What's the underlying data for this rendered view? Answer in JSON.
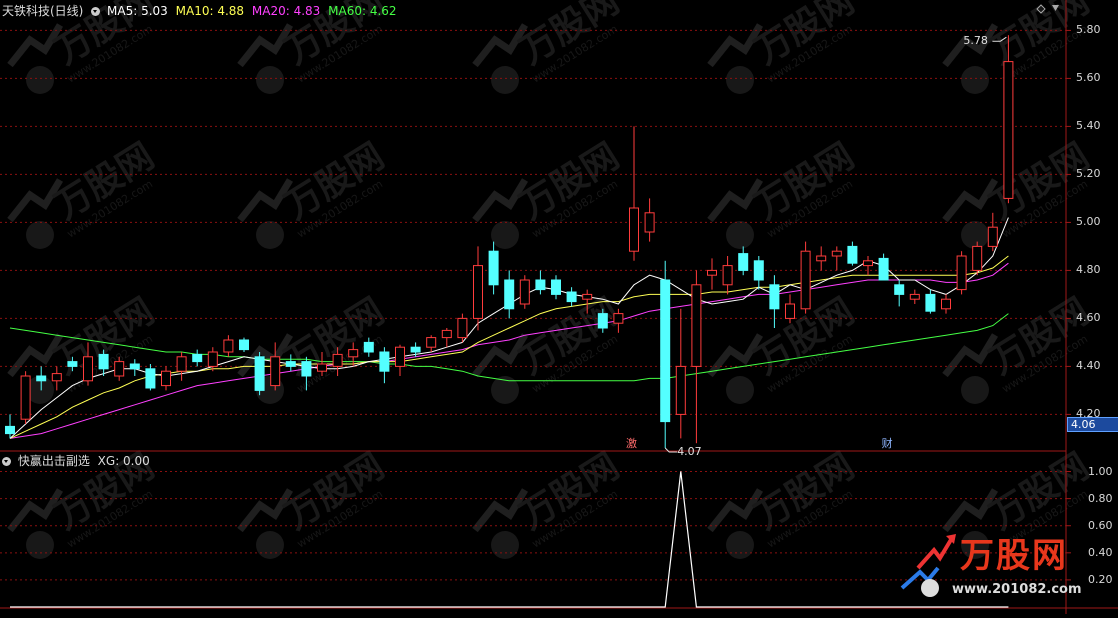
{
  "main_header": {
    "title": "天铁科技(日线)",
    "ma5": "MA5: 5.03",
    "ma10": "MA10: 4.88",
    "ma20": "MA20: 4.83",
    "ma60": "MA60: 4.62",
    "colors": {
      "title": "#dcdcdc",
      "ma5": "#ffffff",
      "ma10": "#ffff55",
      "ma20": "#ff40ff",
      "ma60": "#44ff44"
    }
  },
  "sub_header": {
    "title": "快赢出击副选",
    "xg": "XG: 0.00"
  },
  "markers": {
    "high_label": "5.78",
    "low_label": "4.07",
    "event_1": "激",
    "event_2": "财",
    "current_price": "4.06"
  },
  "watermark": {
    "brand": "万股网",
    "url": "www.201082.com"
  },
  "chart_data": [
    {
      "type": "candlestick",
      "ylim": [
        4.06,
        5.86
      ],
      "y_ticks": [
        "5.80",
        "5.60",
        "5.40",
        "5.20",
        "5.00",
        "4.80",
        "4.60",
        "4.40",
        "4.20"
      ],
      "tick_values": [
        5.8,
        5.6,
        5.4,
        5.2,
        5.0,
        4.8,
        4.6,
        4.4,
        4.2
      ],
      "colors": {
        "up": "#ff3c3c",
        "down": "#54ffff",
        "ma5": "#ffffff",
        "ma10": "#ffff55",
        "ma20": "#ff40ff",
        "ma60": "#44ff44",
        "grid": "#8a1010"
      },
      "candles": [
        {
          "o": 4.15,
          "h": 4.2,
          "l": 4.1,
          "c": 4.12
        },
        {
          "o": 4.18,
          "h": 4.38,
          "l": 4.16,
          "c": 4.36
        },
        {
          "o": 4.36,
          "h": 4.4,
          "l": 4.3,
          "c": 4.34
        },
        {
          "o": 4.34,
          "h": 4.4,
          "l": 4.3,
          "c": 4.37
        },
        {
          "o": 4.42,
          "h": 4.44,
          "l": 4.38,
          "c": 4.4
        },
        {
          "o": 4.34,
          "h": 4.5,
          "l": 4.32,
          "c": 4.44
        },
        {
          "o": 4.45,
          "h": 4.47,
          "l": 4.36,
          "c": 4.39
        },
        {
          "o": 4.36,
          "h": 4.44,
          "l": 4.34,
          "c": 4.42
        },
        {
          "o": 4.41,
          "h": 4.43,
          "l": 4.36,
          "c": 4.39
        },
        {
          "o": 4.39,
          "h": 4.41,
          "l": 4.3,
          "c": 4.31
        },
        {
          "o": 4.32,
          "h": 4.4,
          "l": 4.3,
          "c": 4.38
        },
        {
          "o": 4.38,
          "h": 4.46,
          "l": 4.34,
          "c": 4.44
        },
        {
          "o": 4.45,
          "h": 4.47,
          "l": 4.4,
          "c": 4.42
        },
        {
          "o": 4.4,
          "h": 4.48,
          "l": 4.38,
          "c": 4.46
        },
        {
          "o": 4.46,
          "h": 4.53,
          "l": 4.44,
          "c": 4.51
        },
        {
          "o": 4.51,
          "h": 4.52,
          "l": 4.46,
          "c": 4.47
        },
        {
          "o": 4.44,
          "h": 4.46,
          "l": 4.28,
          "c": 4.3
        },
        {
          "o": 4.32,
          "h": 4.5,
          "l": 4.3,
          "c": 4.44
        },
        {
          "o": 4.42,
          "h": 4.45,
          "l": 4.38,
          "c": 4.4
        },
        {
          "o": 4.42,
          "h": 4.44,
          "l": 4.3,
          "c": 4.36
        },
        {
          "o": 4.38,
          "h": 4.46,
          "l": 4.36,
          "c": 4.41
        },
        {
          "o": 4.4,
          "h": 4.48,
          "l": 4.36,
          "c": 4.45
        },
        {
          "o": 4.44,
          "h": 4.5,
          "l": 4.4,
          "c": 4.47
        },
        {
          "o": 4.5,
          "h": 4.52,
          "l": 4.44,
          "c": 4.46
        },
        {
          "o": 4.46,
          "h": 4.48,
          "l": 4.33,
          "c": 4.38
        },
        {
          "o": 4.4,
          "h": 4.49,
          "l": 4.36,
          "c": 4.48
        },
        {
          "o": 4.48,
          "h": 4.5,
          "l": 4.44,
          "c": 4.46
        },
        {
          "o": 4.48,
          "h": 4.53,
          "l": 4.46,
          "c": 4.52
        },
        {
          "o": 4.52,
          "h": 4.56,
          "l": 4.48,
          "c": 4.55
        },
        {
          "o": 4.52,
          "h": 4.62,
          "l": 4.5,
          "c": 4.6
        },
        {
          "o": 4.6,
          "h": 4.9,
          "l": 4.55,
          "c": 4.82
        },
        {
          "o": 4.88,
          "h": 4.92,
          "l": 4.7,
          "c": 4.74
        },
        {
          "o": 4.76,
          "h": 4.8,
          "l": 4.6,
          "c": 4.64
        },
        {
          "o": 4.66,
          "h": 4.78,
          "l": 4.64,
          "c": 4.76
        },
        {
          "o": 4.76,
          "h": 4.8,
          "l": 4.7,
          "c": 4.72
        },
        {
          "o": 4.76,
          "h": 4.78,
          "l": 4.68,
          "c": 4.7
        },
        {
          "o": 4.71,
          "h": 4.73,
          "l": 4.65,
          "c": 4.67
        },
        {
          "o": 4.68,
          "h": 4.72,
          "l": 4.62,
          "c": 4.7
        },
        {
          "o": 4.62,
          "h": 4.64,
          "l": 4.54,
          "c": 4.56
        },
        {
          "o": 4.58,
          "h": 4.64,
          "l": 4.54,
          "c": 4.62
        },
        {
          "o": 4.88,
          "h": 5.4,
          "l": 4.84,
          "c": 5.06
        },
        {
          "o": 4.96,
          "h": 5.1,
          "l": 4.92,
          "c": 5.04
        },
        {
          "o": 4.76,
          "h": 4.84,
          "l": 4.06,
          "c": 4.17
        },
        {
          "o": 4.2,
          "h": 4.64,
          "l": 4.1,
          "c": 4.4
        },
        {
          "o": 4.4,
          "h": 4.8,
          "l": 4.08,
          "c": 4.74
        },
        {
          "o": 4.78,
          "h": 4.85,
          "l": 4.72,
          "c": 4.8
        },
        {
          "o": 4.74,
          "h": 4.86,
          "l": 4.7,
          "c": 4.82
        },
        {
          "o": 4.87,
          "h": 4.9,
          "l": 4.78,
          "c": 4.8
        },
        {
          "o": 4.84,
          "h": 4.86,
          "l": 4.72,
          "c": 4.76
        },
        {
          "o": 4.74,
          "h": 4.78,
          "l": 4.56,
          "c": 4.64
        },
        {
          "o": 4.6,
          "h": 4.7,
          "l": 4.58,
          "c": 4.66
        },
        {
          "o": 4.64,
          "h": 4.92,
          "l": 4.62,
          "c": 4.88
        },
        {
          "o": 4.84,
          "h": 4.9,
          "l": 4.8,
          "c": 4.86
        },
        {
          "o": 4.86,
          "h": 4.9,
          "l": 4.8,
          "c": 4.88
        },
        {
          "o": 4.9,
          "h": 4.92,
          "l": 4.82,
          "c": 4.83
        },
        {
          "o": 4.82,
          "h": 4.86,
          "l": 4.78,
          "c": 4.84
        },
        {
          "o": 4.85,
          "h": 4.87,
          "l": 4.76,
          "c": 4.76
        },
        {
          "o": 4.74,
          "h": 4.76,
          "l": 4.65,
          "c": 4.7
        },
        {
          "o": 4.68,
          "h": 4.72,
          "l": 4.66,
          "c": 4.7
        },
        {
          "o": 4.7,
          "h": 4.72,
          "l": 4.62,
          "c": 4.63
        },
        {
          "o": 4.64,
          "h": 4.7,
          "l": 4.62,
          "c": 4.68
        },
        {
          "o": 4.72,
          "h": 4.88,
          "l": 4.7,
          "c": 4.86
        },
        {
          "o": 4.8,
          "h": 4.92,
          "l": 4.78,
          "c": 4.9
        },
        {
          "o": 4.9,
          "h": 5.04,
          "l": 4.88,
          "c": 4.98
        },
        {
          "o": 5.1,
          "h": 5.78,
          "l": 5.08,
          "c": 5.67
        }
      ],
      "ma5": [
        4.1,
        4.16,
        4.22,
        4.27,
        4.32,
        4.35,
        4.37,
        4.39,
        4.39,
        4.37,
        4.36,
        4.37,
        4.38,
        4.4,
        4.42,
        4.44,
        4.43,
        4.42,
        4.41,
        4.4,
        4.39,
        4.39,
        4.4,
        4.42,
        4.43,
        4.44,
        4.45,
        4.46,
        4.48,
        4.5,
        4.58,
        4.62,
        4.66,
        4.7,
        4.73,
        4.72,
        4.7,
        4.69,
        4.68,
        4.66,
        4.74,
        4.78,
        4.76,
        4.72,
        4.68,
        4.66,
        4.67,
        4.68,
        4.73,
        4.7,
        4.74,
        4.72,
        4.75,
        4.78,
        4.8,
        4.84,
        4.82,
        4.76,
        4.76,
        4.72,
        4.7,
        4.74,
        4.79,
        4.86,
        5.02
      ],
      "ma10": [
        4.1,
        4.13,
        4.16,
        4.19,
        4.23,
        4.26,
        4.29,
        4.31,
        4.34,
        4.36,
        4.37,
        4.38,
        4.38,
        4.39,
        4.39,
        4.4,
        4.4,
        4.4,
        4.41,
        4.41,
        4.41,
        4.41,
        4.41,
        4.42,
        4.42,
        4.42,
        4.43,
        4.44,
        4.45,
        4.46,
        4.5,
        4.53,
        4.56,
        4.59,
        4.62,
        4.64,
        4.65,
        4.66,
        4.67,
        4.67,
        4.69,
        4.7,
        4.7,
        4.7,
        4.7,
        4.71,
        4.71,
        4.72,
        4.73,
        4.73,
        4.74,
        4.75,
        4.76,
        4.77,
        4.78,
        4.78,
        4.78,
        4.78,
        4.78,
        4.78,
        4.78,
        4.78,
        4.79,
        4.81,
        4.86
      ],
      "ma20": [
        4.1,
        4.11,
        4.12,
        4.14,
        4.16,
        4.18,
        4.2,
        4.22,
        4.24,
        4.26,
        4.28,
        4.3,
        4.32,
        4.33,
        4.34,
        4.35,
        4.36,
        4.37,
        4.38,
        4.39,
        4.4,
        4.41,
        4.41,
        4.42,
        4.42,
        4.43,
        4.44,
        4.45,
        4.46,
        4.47,
        4.49,
        4.5,
        4.51,
        4.53,
        4.54,
        4.55,
        4.56,
        4.57,
        4.58,
        4.59,
        4.61,
        4.63,
        4.64,
        4.65,
        4.66,
        4.67,
        4.68,
        4.69,
        4.7,
        4.7,
        4.71,
        4.72,
        4.73,
        4.74,
        4.75,
        4.76,
        4.76,
        4.76,
        4.76,
        4.76,
        4.75,
        4.75,
        4.76,
        4.78,
        4.83
      ],
      "ma60": [
        4.56,
        4.55,
        4.54,
        4.53,
        4.52,
        4.51,
        4.5,
        4.49,
        4.48,
        4.47,
        4.46,
        4.46,
        4.45,
        4.45,
        4.44,
        4.44,
        4.43,
        4.43,
        4.43,
        4.43,
        4.42,
        4.42,
        4.42,
        4.42,
        4.41,
        4.41,
        4.4,
        4.4,
        4.39,
        4.38,
        4.36,
        4.35,
        4.34,
        4.34,
        4.34,
        4.34,
        4.34,
        4.34,
        4.34,
        4.34,
        4.34,
        4.35,
        4.35,
        4.36,
        4.37,
        4.38,
        4.39,
        4.4,
        4.41,
        4.42,
        4.43,
        4.44,
        4.45,
        4.46,
        4.47,
        4.48,
        4.49,
        4.5,
        4.51,
        4.52,
        4.53,
        4.54,
        4.55,
        4.57,
        4.62
      ]
    },
    {
      "type": "line",
      "ylim": [
        0,
        1.1
      ],
      "y_ticks": [
        "1.00",
        "0.80",
        "0.60",
        "0.40",
        "0.20"
      ],
      "tick_values": [
        1.0,
        0.8,
        0.6,
        0.4,
        0.2
      ],
      "values": [
        0,
        0,
        0,
        0,
        0,
        0,
        0,
        0,
        0,
        0,
        0,
        0,
        0,
        0,
        0,
        0,
        0,
        0,
        0,
        0,
        0,
        0,
        0,
        0,
        0,
        0,
        0,
        0,
        0,
        0,
        0,
        0,
        0,
        0,
        0,
        0,
        0,
        0,
        0,
        0,
        0,
        0,
        0,
        1,
        0,
        0,
        0,
        0,
        0,
        0,
        0,
        0,
        0,
        0,
        0,
        0,
        0,
        0,
        0,
        0,
        0,
        0,
        0,
        0,
        0
      ]
    }
  ]
}
